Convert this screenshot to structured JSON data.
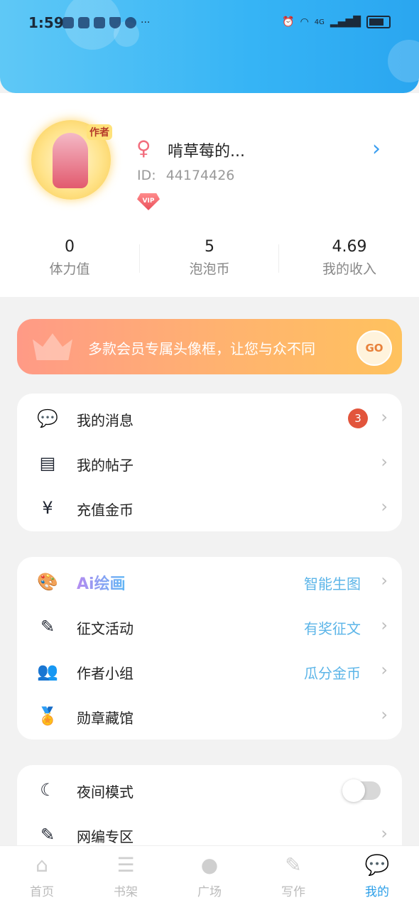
{
  "status_bar": {
    "time": "1:59",
    "more": "···",
    "network": "4G"
  },
  "profile": {
    "avatar_tag": "作者",
    "gender_symbol": "♀",
    "username": "啃草莓的...",
    "id_label": "ID:",
    "id_value": "44174426",
    "vip_label": "VIP",
    "stats": [
      {
        "value": "0",
        "label": "体力值"
      },
      {
        "value": "5",
        "label": "泡泡币"
      },
      {
        "value": "4.69",
        "label": "我的收入"
      }
    ]
  },
  "banner": {
    "text": "多款会员专属头像框，让您与众不同",
    "go_label": "GO"
  },
  "menu1": [
    {
      "label": "我的消息",
      "badge": "3"
    },
    {
      "label": "我的帖子"
    },
    {
      "label": "充值金币"
    }
  ],
  "menu2": [
    {
      "label": "Ai绘画",
      "extra": "智能生图"
    },
    {
      "label": "征文活动",
      "extra": "有奖征文"
    },
    {
      "label": "作者小组",
      "extra": "瓜分金币"
    },
    {
      "label": "勋章藏馆"
    }
  ],
  "menu3": [
    {
      "label": "夜间模式",
      "toggle": false
    },
    {
      "label": "网编专区"
    }
  ],
  "tabs": [
    {
      "label": "首页",
      "icon": "home-icon"
    },
    {
      "label": "书架",
      "icon": "bookshelf-icon"
    },
    {
      "label": "广场",
      "icon": "planet-icon"
    },
    {
      "label": "写作",
      "icon": "pen-icon"
    },
    {
      "label": "我的",
      "icon": "chat-bubble-icon",
      "active": true
    }
  ],
  "colors": {
    "header": "#36b4f5",
    "accent": "#3ab0f2",
    "link_text": "#5cb5e8",
    "badge": "#e2553c",
    "banner_start": "#ff9a86",
    "banner_end": "#ffc25e"
  }
}
